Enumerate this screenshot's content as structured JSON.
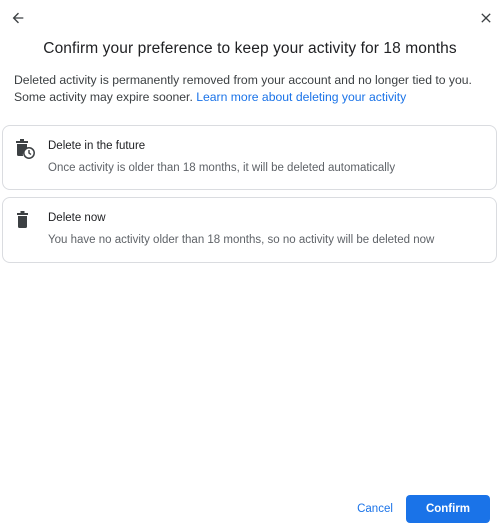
{
  "header": {
    "back_icon": "arrow-back-icon",
    "close_icon": "close-icon"
  },
  "dialog": {
    "title": "Confirm your preference to keep your activity for 18 months",
    "description": "Deleted activity is permanently removed from your account and no longer tied to you. Some activity may expire sooner.",
    "learn_more_link": "Learn more about deleting your activity"
  },
  "options": [
    {
      "icon": "trash-clock-icon",
      "title": "Delete in the future",
      "subtitle": "Once activity is older than 18 months, it will be deleted automatically"
    },
    {
      "icon": "trash-icon",
      "title": "Delete now",
      "subtitle": "You have no activity older than 18 months, so no activity will be deleted now"
    }
  ],
  "actions": {
    "cancel_label": "Cancel",
    "confirm_label": "Confirm"
  },
  "colors": {
    "accent": "#1a73e8",
    "border": "#dadce0",
    "text_primary": "#202124",
    "text_secondary": "#5f6368"
  }
}
